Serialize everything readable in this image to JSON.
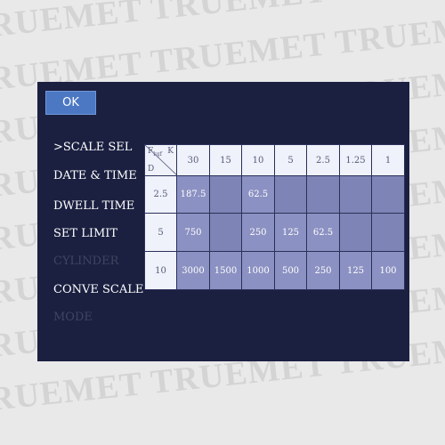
{
  "watermark": {
    "text": "TRUEMET TRUEMET TRUEMET TRUEMET TRUEMET"
  },
  "screen": {
    "ok_label": "OK",
    "menu": [
      {
        "label": ">SCALE SEL",
        "state": "selected"
      },
      {
        "label": "DATE & TIME",
        "state": "normal"
      },
      {
        "label": "DWELL TIME",
        "state": "normal"
      },
      {
        "label": "SET LIMIT",
        "state": "normal"
      },
      {
        "label": "CYLINDER",
        "state": "disabled"
      },
      {
        "label": "CONVE SCALE",
        "state": "normal"
      },
      {
        "label": "MODE",
        "state": "disabled"
      }
    ],
    "table": {
      "corner": {
        "f_label": "F",
        "f_sub": "kgf",
        "k_label": "K",
        "d_label": "D"
      },
      "k_headers": [
        "30",
        "15",
        "10",
        "5",
        "2.5",
        "1.25",
        "1"
      ],
      "rows": [
        {
          "d": "2.5",
          "cells": [
            "187.5",
            "",
            "62.5",
            "",
            "",
            "",
            ""
          ]
        },
        {
          "d": "5",
          "cells": [
            "750",
            "",
            "250",
            "125",
            "62.5",
            "",
            ""
          ]
        },
        {
          "d": "10",
          "cells": [
            "3000",
            "1500",
            "1000",
            "500",
            "250",
            "125",
            "100"
          ]
        }
      ]
    }
  },
  "colors": {
    "screen_bg": "#1b2041",
    "ok_bg": "#4c78c3",
    "header_bg": "#eff1fb",
    "cell_bg": "#8b91c2"
  }
}
